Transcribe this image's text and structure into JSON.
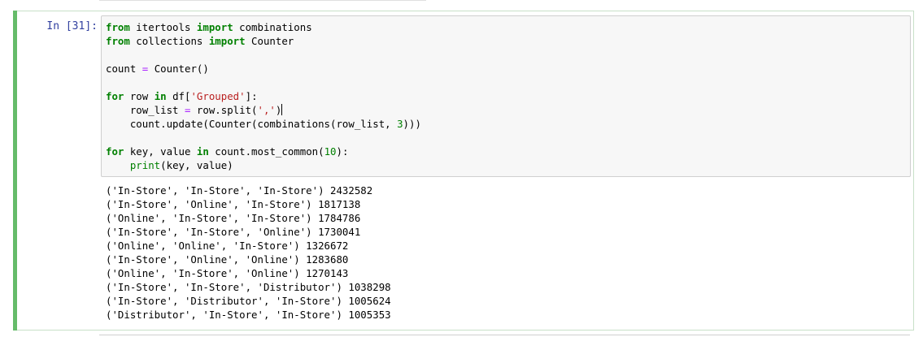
{
  "cell": {
    "prompt": "In [31]:",
    "accent_color": "#66bb6a",
    "code_lines": [
      [
        {
          "t": "kw",
          "v": "from"
        },
        {
          "t": "",
          "v": " itertools "
        },
        {
          "t": "kw",
          "v": "import"
        },
        {
          "t": "",
          "v": " combinations"
        }
      ],
      [
        {
          "t": "kw",
          "v": "from"
        },
        {
          "t": "",
          "v": " collections "
        },
        {
          "t": "kw",
          "v": "import"
        },
        {
          "t": "",
          "v": " Counter"
        }
      ],
      [],
      [
        {
          "t": "",
          "v": "count "
        },
        {
          "t": "op",
          "v": "="
        },
        {
          "t": "",
          "v": " Counter()"
        }
      ],
      [],
      [
        {
          "t": "kw",
          "v": "for"
        },
        {
          "t": "",
          "v": " row "
        },
        {
          "t": "kw",
          "v": "in"
        },
        {
          "t": "",
          "v": " df["
        },
        {
          "t": "str",
          "v": "'Grouped'"
        },
        {
          "t": "",
          "v": "]:"
        }
      ],
      [
        {
          "t": "",
          "v": "    row_list "
        },
        {
          "t": "op",
          "v": "="
        },
        {
          "t": "",
          "v": " row.split("
        },
        {
          "t": "str",
          "v": "','"
        },
        {
          "t": "",
          "v": ")"
        },
        {
          "t": "cursor",
          "v": ""
        }
      ],
      [
        {
          "t": "",
          "v": "    count.update(Counter(combinations(row_list, "
        },
        {
          "t": "num",
          "v": "3"
        },
        {
          "t": "",
          "v": ")))"
        }
      ],
      [],
      [
        {
          "t": "kw",
          "v": "for"
        },
        {
          "t": "",
          "v": " key, value "
        },
        {
          "t": "kw",
          "v": "in"
        },
        {
          "t": "",
          "v": " count.most_common("
        },
        {
          "t": "num",
          "v": "10"
        },
        {
          "t": "",
          "v": "):"
        }
      ],
      [
        {
          "t": "",
          "v": "    "
        },
        {
          "t": "bi",
          "v": "print"
        },
        {
          "t": "",
          "v": "(key, value)"
        }
      ]
    ],
    "output_lines": [
      "('In-Store', 'In-Store', 'In-Store') 2432582",
      "('In-Store', 'Online', 'In-Store') 1817138",
      "('Online', 'In-Store', 'In-Store') 1784786",
      "('In-Store', 'In-Store', 'Online') 1730041",
      "('Online', 'Online', 'In-Store') 1326672",
      "('In-Store', 'Online', 'Online') 1283680",
      "('Online', 'In-Store', 'Online') 1270143",
      "('In-Store', 'In-Store', 'Distributor') 1038298",
      "('In-Store', 'Distributor', 'In-Store') 1005624",
      "('Distributor', 'In-Store', 'In-Store') 1005353"
    ]
  }
}
